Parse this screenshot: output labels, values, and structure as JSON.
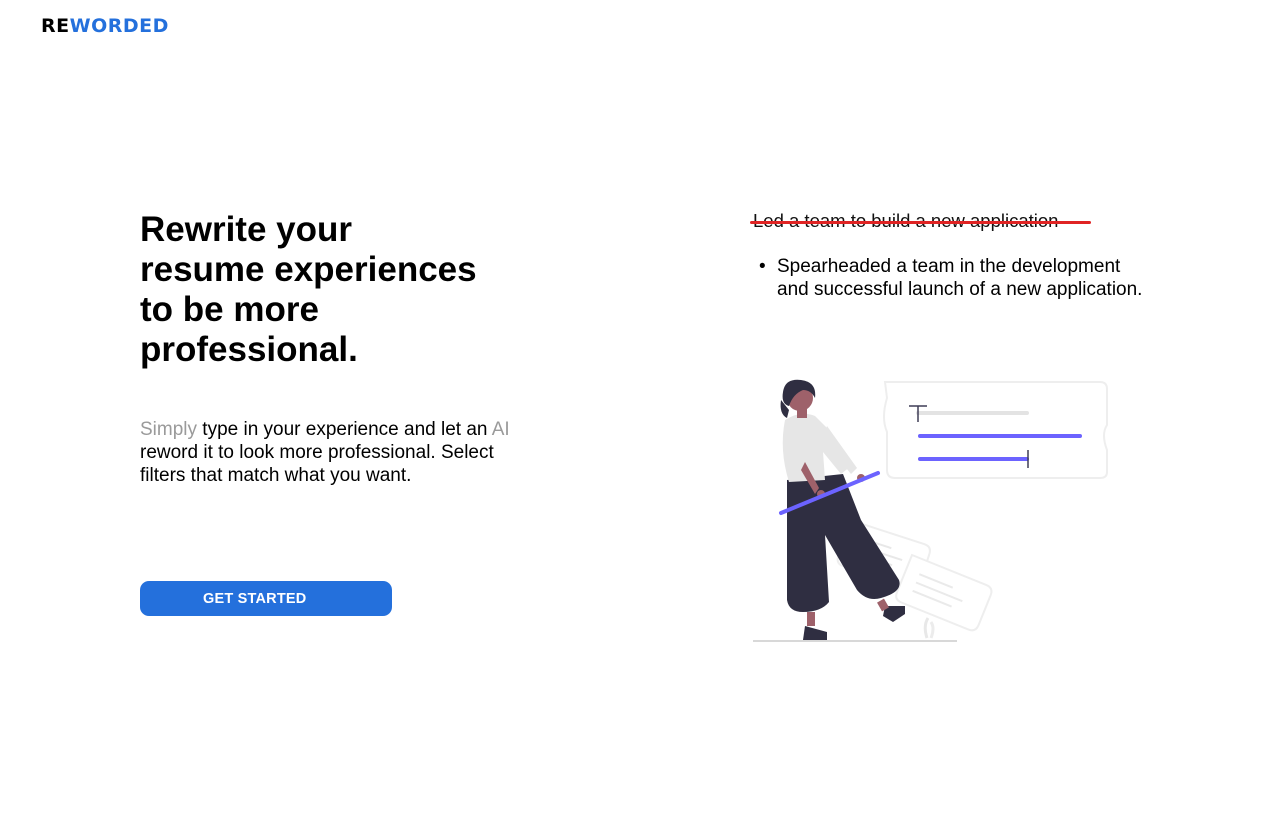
{
  "brand": {
    "prefix": "RE",
    "suffix": "WORDED",
    "accent_color": "#2470dc"
  },
  "hero": {
    "headline": "Rewrite your resume experiences to be more professional.",
    "description": {
      "word_simply": "Simply",
      "part1": " type in your experience and let an ",
      "word_ai": "AI",
      "part2": " reword it to look more professional. Select filters that match what you want."
    },
    "cta_label": "GET STARTED"
  },
  "example": {
    "original": "Led a team to build a new application",
    "bullet": "•",
    "reworded": "Spearheaded a team in the development and successful launch of a new application."
  },
  "colors": {
    "strike": "#e02424",
    "illustration_accent": "#6c63ff",
    "figure_dark": "#2f2e41"
  }
}
